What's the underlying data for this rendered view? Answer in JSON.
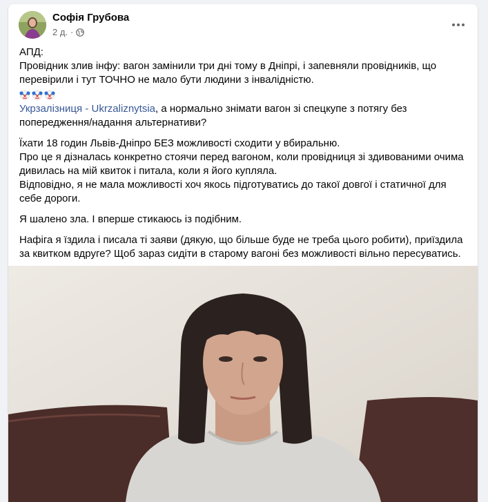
{
  "post": {
    "author": "Софія Грубова",
    "time": "2 д.",
    "separator": "·",
    "audience_icon": "globe-icon",
    "more_icon": "more-options-icon"
  },
  "content": {
    "line1": "АПД:",
    "line2": "Провідник злив інфу: вагон замінили три дні тому в Дніпрі, і запевняли провідників, що перевірили і тут ТОЧНО не мало бути людини з інвалідністю.",
    "emoji_icon": "clown-face-icon",
    "mention": "Укрзалізниця - Ukrzaliznytsia",
    "mention_rest": ", а нормально знімати вагон зі спецкупе з потягу без попередження/надання альтернативи?",
    "para3_line1": "Їхати 18 годин Львів-Дніпро БЕЗ можливості сходити у вбиральню.",
    "para3_line2": "Про це я дізналась конкретно стоячи перед вагоном, коли провідниця зі здивованими очима дивилась на мій квиток і питала, коли я його купляла.",
    "para3_line3": "Відповідно, я не мала можливості хоч якось підготуватись до такої довгої і статичної для себе дороги.",
    "para4": "Я шалено зла. І вперше стикаюсь із подібним.",
    "para5": "Нафіга я їздила і писала ті заяви (дякую, що більше буде не треба цього робити), приїздила за квитком вдруге? Щоб зараз сидіти в старому вагоні без можливості вільно пересуватись."
  },
  "colors": {
    "link": "#385898",
    "secondary_text": "#65676b",
    "background": "#f0f2f5"
  }
}
